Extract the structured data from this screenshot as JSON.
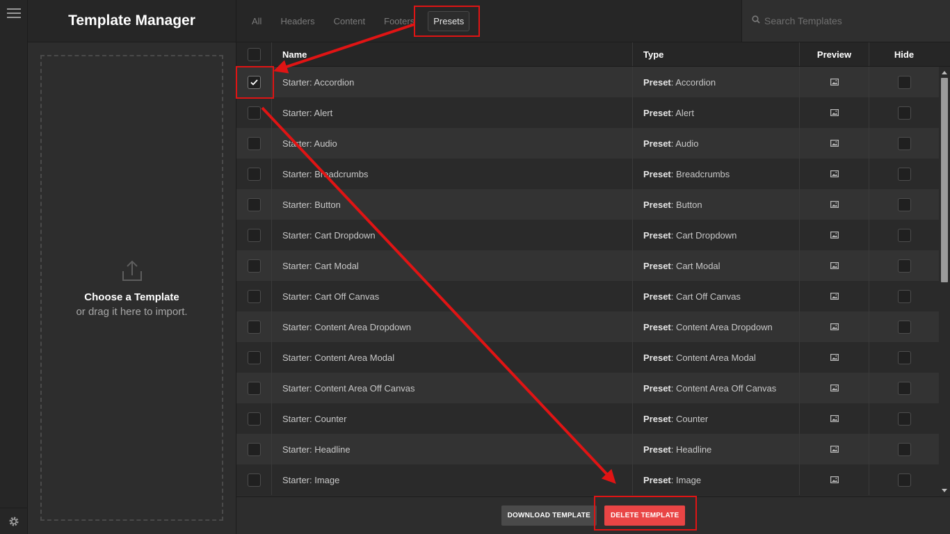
{
  "app": {
    "title": "Template Manager"
  },
  "import": {
    "title": "Choose a Template",
    "subtitle": "or drag it here to import."
  },
  "tabs": [
    {
      "label": "All",
      "active": false
    },
    {
      "label": "Headers",
      "active": false
    },
    {
      "label": "Content",
      "active": false
    },
    {
      "label": "Footers",
      "active": false
    },
    {
      "label": "Presets",
      "active": true
    }
  ],
  "search": {
    "placeholder": "Search Templates",
    "value": ""
  },
  "table": {
    "headers": {
      "name": "Name",
      "type": "Type",
      "preview": "Preview",
      "hide": "Hide"
    },
    "rows": [
      {
        "name": "Starter: Accordion",
        "type_prefix": "Preset",
        "type_value": ": Accordion",
        "checked": true
      },
      {
        "name": "Starter: Alert",
        "type_prefix": "Preset",
        "type_value": ": Alert",
        "checked": false
      },
      {
        "name": "Starter: Audio",
        "type_prefix": "Preset",
        "type_value": ": Audio",
        "checked": false
      },
      {
        "name": "Starter: Breadcrumbs",
        "type_prefix": "Preset",
        "type_value": ": Breadcrumbs",
        "checked": false
      },
      {
        "name": "Starter: Button",
        "type_prefix": "Preset",
        "type_value": ": Button",
        "checked": false
      },
      {
        "name": "Starter: Cart Dropdown",
        "type_prefix": "Preset",
        "type_value": ": Cart Dropdown",
        "checked": false
      },
      {
        "name": "Starter: Cart Modal",
        "type_prefix": "Preset",
        "type_value": ": Cart Modal",
        "checked": false
      },
      {
        "name": "Starter: Cart Off Canvas",
        "type_prefix": "Preset",
        "type_value": ": Cart Off Canvas",
        "checked": false
      },
      {
        "name": "Starter: Content Area Dropdown",
        "type_prefix": "Preset",
        "type_value": ": Content Area Dropdown",
        "checked": false
      },
      {
        "name": "Starter: Content Area Modal",
        "type_prefix": "Preset",
        "type_value": ": Content Area Modal",
        "checked": false
      },
      {
        "name": "Starter: Content Area Off Canvas",
        "type_prefix": "Preset",
        "type_value": ": Content Area Off Canvas",
        "checked": false
      },
      {
        "name": "Starter: Counter",
        "type_prefix": "Preset",
        "type_value": ": Counter",
        "checked": false
      },
      {
        "name": "Starter: Headline",
        "type_prefix": "Preset",
        "type_value": ": Headline",
        "checked": false
      },
      {
        "name": "Starter: Image",
        "type_prefix": "Preset",
        "type_value": ": Image",
        "checked": false
      }
    ]
  },
  "footer": {
    "download_label": "DOWNLOAD TEMPLATE",
    "delete_label": "DELETE TEMPLATE"
  },
  "colors": {
    "accent_delete": "#e94545",
    "annotation": "#e01414"
  },
  "icons": {
    "menu": "hamburger-menu-icon",
    "settings": "gear-icon",
    "upload": "upload-icon",
    "search": "search-icon",
    "preview": "image-icon",
    "check": "checkmark-icon"
  }
}
